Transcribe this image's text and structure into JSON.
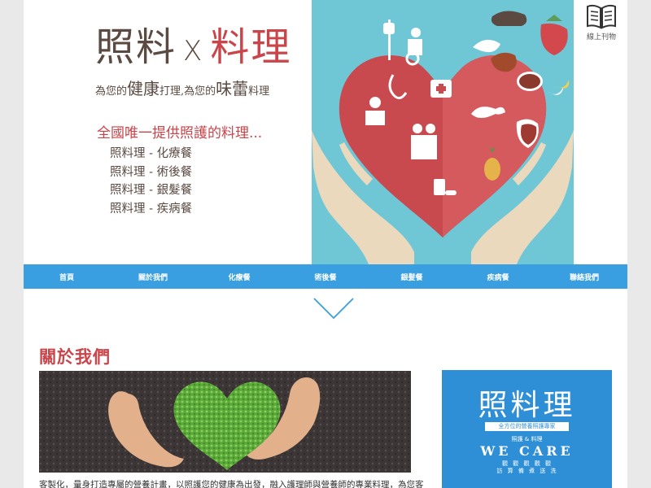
{
  "brand": {
    "title_part1": "照料",
    "title_x": "X",
    "title_part2": "料理",
    "sub_small1": "為您的",
    "sub_big1": "健康",
    "sub_small2": "打理,為您的",
    "sub_big2": "味蕾",
    "sub_small3": "料理"
  },
  "slogan": "全國唯一提供照護的料理...",
  "meals": [
    "照料理 - 化療餐",
    "照料理 - 術後餐",
    "照料理 - 銀髮餐",
    "照料理 - 疾病餐"
  ],
  "magazine": {
    "label": "線上刊物",
    "icon": "book-icon"
  },
  "nav": [
    "首頁",
    "關於我們",
    "化療餐",
    "術後餐",
    "銀髮餐",
    "疾病餐",
    "聯絡我們"
  ],
  "about": {
    "title": "關於我們",
    "text": "客製化，量身打造專屬的營養計畫，以照護您的健康為出發，融入護理師與營養師的專業料理，為您客"
  },
  "side_card": {
    "logo": "照料理",
    "tagline": "全方位的營養照護專家",
    "care_line": "照護 & 料理",
    "wecare": "WE CARE",
    "lines": [
      "觀 觀 觀 觀 觀",
      "訪 算 備 煮 送 洗"
    ]
  },
  "colors": {
    "accent_red": "#c9454a",
    "brown": "#5b4a42",
    "nav_blue": "#3a9fe0",
    "hero_teal": "#6fc7d6",
    "card_blue": "#2f8fd6"
  }
}
